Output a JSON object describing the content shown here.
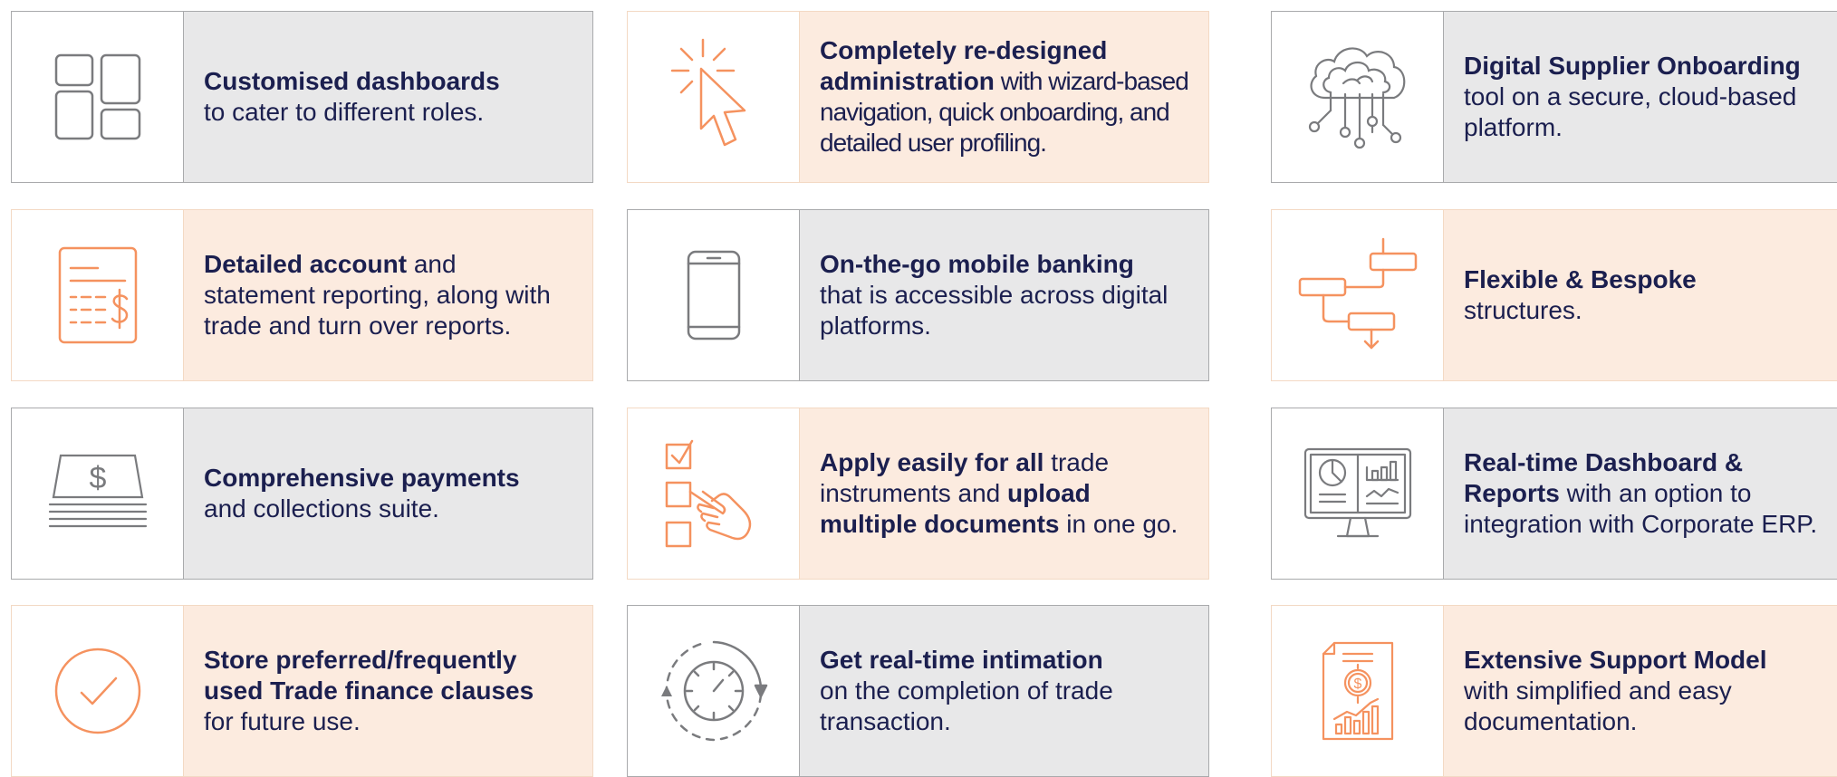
{
  "colors": {
    "navy": "#1b1f4f",
    "orange": "#f5925f",
    "gray_icon": "#7a7b7e",
    "gray_bg": "#e8e8e9",
    "peach_bg": "#fcebdf"
  },
  "cards": [
    {
      "icon": "dashboard-grid-icon",
      "bold1": "Customised dashboards",
      "reg1": "",
      "bold2": "",
      "reg2": "to cater to different roles."
    },
    {
      "icon": "cursor-click-icon",
      "bold1": "Completely re-designed administration",
      "reg1": " with wizard-based navigation, quick onboarding, and detailed user profiling.",
      "bold2": "",
      "reg2": ""
    },
    {
      "icon": "cloud-network-icon",
      "bold1": "Digital Supplier Onboarding",
      "reg1": "",
      "bold2": "",
      "reg2": "tool on a secure, cloud-based platform."
    },
    {
      "icon": "statement-report-icon",
      "bold1": "Detailed account",
      "reg1": " and statement reporting, along with trade and turn over reports.",
      "bold2": "",
      "reg2": ""
    },
    {
      "icon": "mobile-phone-icon",
      "bold1": "On-the-go mobile banking",
      "reg1": "",
      "bold2": "",
      "reg2": "that is accessible across digital platforms."
    },
    {
      "icon": "flow-structure-icon",
      "bold1": "Flexible & Bespoke",
      "reg1": "",
      "bold2": "",
      "reg2": "structures."
    },
    {
      "icon": "cash-stack-icon",
      "bold1": "Comprehensive payments",
      "reg1": "",
      "bold2": "",
      "reg2": "and collections suite."
    },
    {
      "icon": "checklist-hand-icon",
      "bold1": "Apply easily for all",
      "reg1": " trade instruments and ",
      "bold2": "upload multiple documents",
      "reg2": " in one go."
    },
    {
      "icon": "monitor-dashboard-icon",
      "bold1": "Real-time Dashboard & Reports",
      "reg1": " with an option to integration with Corporate ERP.",
      "bold2": "",
      "reg2": ""
    },
    {
      "icon": "check-circle-icon",
      "bold1": "Store preferred/frequently used Trade finance clauses",
      "reg1": "",
      "bold2": "",
      "reg2": "for future use."
    },
    {
      "icon": "timer-cycle-icon",
      "bold1": "Get real-time intimation",
      "reg1": "",
      "bold2": "",
      "reg2": "on the completion of trade transaction."
    },
    {
      "icon": "support-document-icon",
      "bold1": "Extensive Support Model",
      "reg1": "",
      "bold2": "",
      "reg2": "with simplified and easy documentation."
    }
  ]
}
